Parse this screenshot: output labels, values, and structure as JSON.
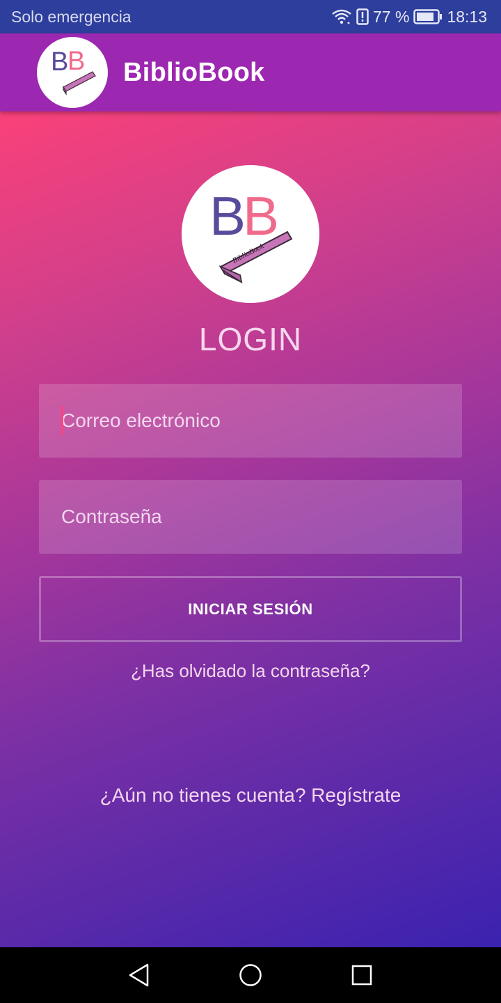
{
  "status_bar": {
    "carrier": "Solo emergencia",
    "battery_text": "77 %",
    "time": "18:13",
    "icons": [
      "wifi-icon",
      "alert-icon",
      "battery-icon"
    ]
  },
  "app_bar": {
    "title": "BiblioBook",
    "logo_text": "BB",
    "logo_ribbon": "BiblioBook"
  },
  "login": {
    "logo_text": "BB",
    "logo_ribbon": "BiblioBook",
    "title": "LOGIN",
    "email": {
      "placeholder": "Correo electrónico",
      "value": ""
    },
    "password": {
      "placeholder": "Contraseña",
      "value": ""
    },
    "submit_label": "INICIAR SESIÓN",
    "forgot_label": "¿Has olvidado la contraseña?",
    "register_label": "¿Aún no tienes cuenta? Regístrate"
  },
  "nav_bar": {
    "icons": [
      "back-icon",
      "home-icon",
      "recents-icon"
    ]
  },
  "colors": {
    "status_bar": "#2d3e9c",
    "app_bar": "#9c27b0",
    "gradient_start": "#fa4179",
    "gradient_end": "#3b22b0",
    "accent": "#ff4081",
    "logo_purple": "#5a4a9c",
    "logo_pink": "#f06a8c"
  }
}
